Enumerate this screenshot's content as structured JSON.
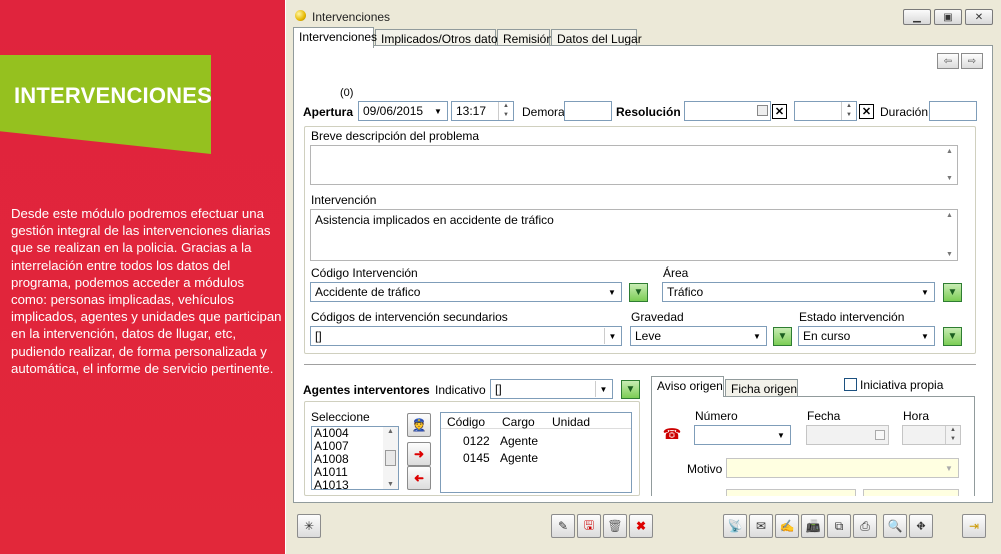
{
  "sidebar": {
    "banner_title": "INTERVENCIONES",
    "description": "Desde este módulo podremos efectuar una gestión integral de las intervenciones diarias que se realizan en la policia. Gracias a la interrelación entre todos los datos del programa, podemos acceder a módulos como: personas implicadas, vehículos implicados, agentes y unidades que participan en la intervención, datos de llugar, etc, pudiendo realizar, de forma personalizada y automática, el informe de servicio pertinente.",
    "banner_color": "#95c11f",
    "background_color": "#e1253b"
  },
  "window": {
    "title": "Intervenciones",
    "tabs": [
      "Intervenciones",
      "Implicados/Otros datos",
      "Remisión",
      "Datos del Lugar"
    ],
    "active_tab": "Intervenciones"
  },
  "form": {
    "counter": "(0)",
    "apertura_label": "Apertura",
    "apertura_date": "09/06/2015",
    "apertura_time": "13:17",
    "demora_label": "Demora",
    "demora_value": "",
    "resolucion_label": "Resolución",
    "resolucion_date": "",
    "resolucion_time": "",
    "duracion_label": "Duración",
    "duracion_value": "",
    "breve_label": "Breve descripción del problema",
    "breve_value": "",
    "intervencion_label": "Intervención",
    "intervencion_value": "Asistencia implicados en accidente de tráfico",
    "codigo_label": "Código Intervención",
    "codigo_value": "Accidente de tráfico",
    "area_label": "Área",
    "area_value": "Tráfico",
    "secundarios_label": "Códigos de intervención secundarios",
    "secundarios_value": "[]",
    "gravedad_label": "Gravedad",
    "gravedad_value": "Leve",
    "estado_label": "Estado intervención",
    "estado_value": "En curso"
  },
  "agentes": {
    "title": "Agentes interventores",
    "indicativo_label": "Indicativo",
    "indicativo_value": "[]",
    "seleccione_label": "Seleccione",
    "available": [
      "A1004",
      "A1007",
      "A1008",
      "A1011",
      "A1013"
    ],
    "columns": [
      "Código",
      "Cargo",
      "Unidad"
    ],
    "rows": [
      {
        "codigo": "0122",
        "cargo": "Agente",
        "unidad": ""
      },
      {
        "codigo": "0145",
        "cargo": "Agente",
        "unidad": ""
      }
    ]
  },
  "aviso": {
    "tabs": [
      "Aviso origen",
      "Ficha origen"
    ],
    "iniciativa_label": "Iniciativa propia",
    "numero_label": "Número",
    "fecha_label": "Fecha",
    "hora_label": "Hora",
    "motivo_label": "Motivo",
    "numero_value": "",
    "fecha_value": "",
    "hora_value": "",
    "motivo_value": ""
  },
  "toolbar": {
    "left": [
      "new-record-icon"
    ],
    "middle": [
      "edit-icon",
      "save-icon",
      "trash-icon",
      "cancel-icon"
    ],
    "right": [
      "radio-icon",
      "mail-icon",
      "sign-icon",
      "fax-icon",
      "copy-icon",
      "print-icon",
      "search-icon",
      "road-icon",
      "exit-icon"
    ]
  }
}
